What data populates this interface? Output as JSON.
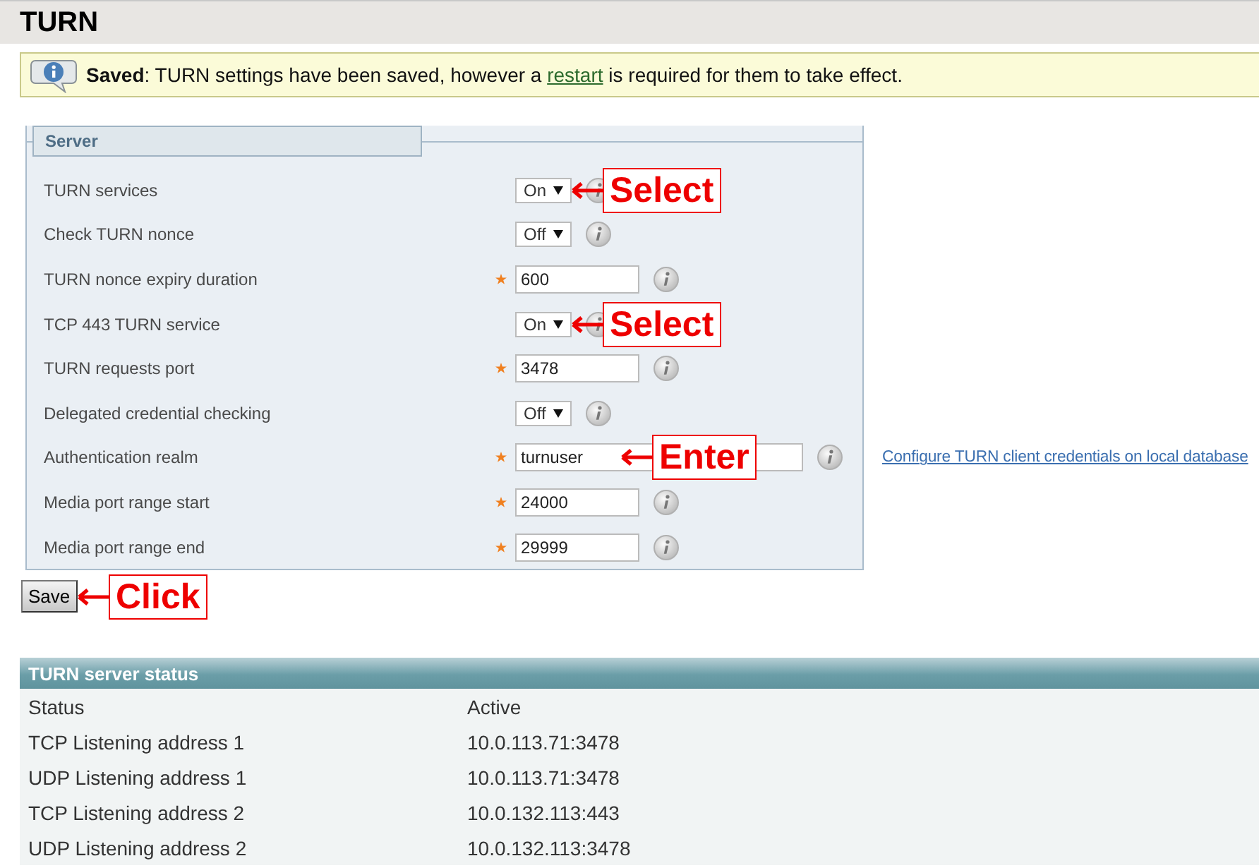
{
  "page": {
    "title": "TURN"
  },
  "notice": {
    "label": "Saved",
    "text": ": TURN settings have been saved, however a ",
    "link": "restart",
    "text_end": " is required for them to take effect."
  },
  "server": {
    "legend": "Server",
    "fields": [
      {
        "label": "TURN services",
        "kind": "select",
        "value": "On",
        "required": false,
        "callout": "Select"
      },
      {
        "label": "Check TURN nonce",
        "kind": "select",
        "value": "Off",
        "required": false
      },
      {
        "label": "TURN nonce expiry duration",
        "kind": "text",
        "value": "600",
        "required": true
      },
      {
        "label": "TCP 443 TURN service",
        "kind": "select",
        "value": "On",
        "required": false,
        "callout": "Select"
      },
      {
        "label": "TURN requests port",
        "kind": "text",
        "value": "3478",
        "required": true
      },
      {
        "label": "Delegated credential checking",
        "kind": "select",
        "value": "Off",
        "required": false
      },
      {
        "label": "Authentication realm",
        "kind": "wide",
        "value": "turnuser",
        "required": true,
        "callout": "Enter",
        "link": "Configure TURN client credentials on local database"
      },
      {
        "label": "Media port range start",
        "kind": "text",
        "value": "24000",
        "required": true
      },
      {
        "label": "Media port range end",
        "kind": "text",
        "value": "29999",
        "required": true
      }
    ]
  },
  "save_button": {
    "label": "Save",
    "callout": "Click"
  },
  "status": {
    "title": "TURN server status",
    "rows": [
      {
        "name": "Status",
        "value": "Active"
      },
      {
        "name": "TCP Listening address 1",
        "value": "10.0.113.71:3478"
      },
      {
        "name": "UDP Listening address 1",
        "value": "10.0.113.71:3478"
      },
      {
        "name": "TCP Listening address 2",
        "value": "10.0.132.113:443"
      },
      {
        "name": "UDP Listening address 2",
        "value": "10.0.132.113:3478"
      }
    ]
  }
}
